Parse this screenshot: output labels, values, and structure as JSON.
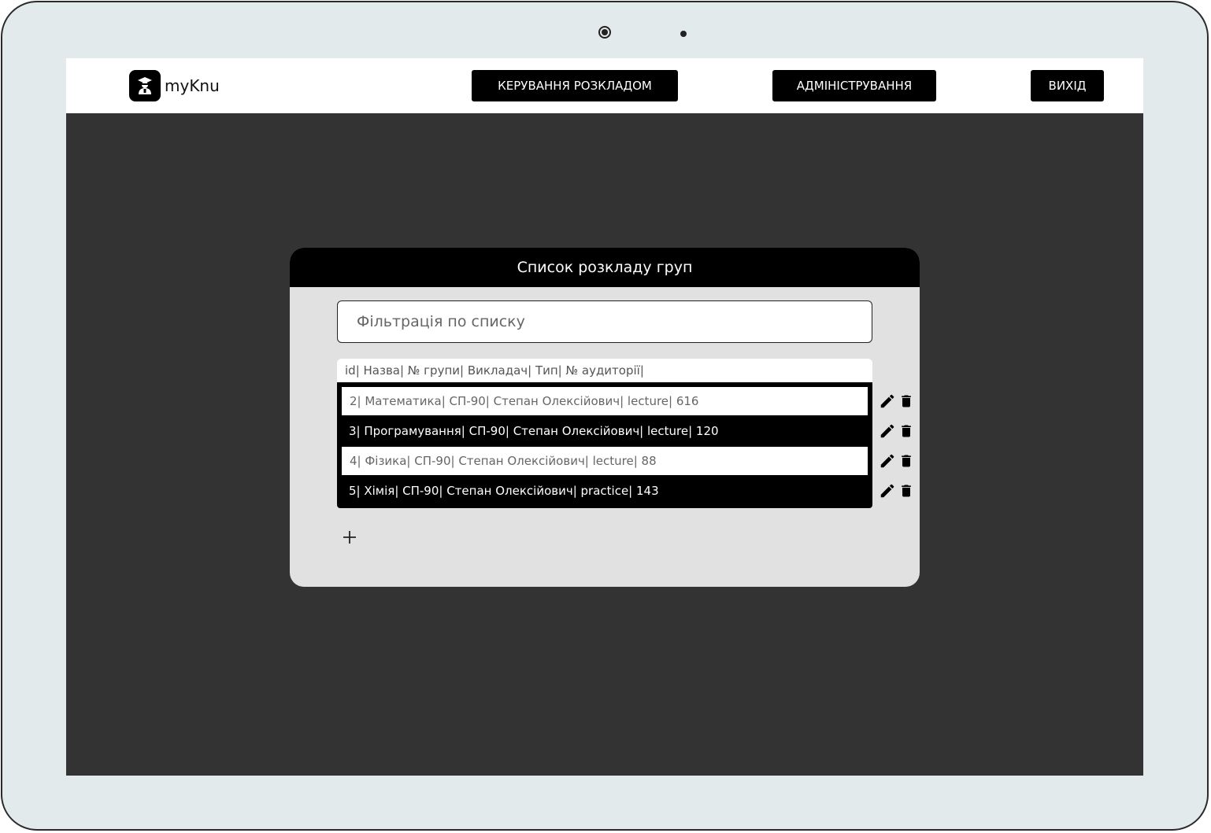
{
  "app": {
    "logo_text": "myKnu"
  },
  "nav": {
    "schedule_label": "КЕРУВАННЯ РОЗКЛАДОМ",
    "admin_label": "АДМІНІСТРУВАННЯ",
    "exit_label": "ВИХІД"
  },
  "card": {
    "title": "Список розкладу груп",
    "filter_placeholder": "Фільтрація по списку",
    "list_header": "id| Назва| № групи| Викладач| Тип| № аудиторії|",
    "rows": [
      {
        "text": "2| Математика| СП-90| Степан Олексійович| lecture| 616"
      },
      {
        "text": "3| Програмування| СП-90| Степан Олексійович| lecture| 120"
      },
      {
        "text": "4| Фізика| СП-90| Степан Олексійович| lecture| 88"
      },
      {
        "text": "5| Хімія| СП-90| Степан Олексійович| practice| 143"
      }
    ]
  },
  "icons": {
    "row_actions": [
      "pencil-icon",
      "trash-icon"
    ],
    "add": "plus-icon",
    "logo": "graduate-icon"
  },
  "colors": {
    "device_frame": "#e2eaeb",
    "screen_background": "#333333",
    "card_background": "#e1e1e1",
    "accent": "#000000"
  }
}
